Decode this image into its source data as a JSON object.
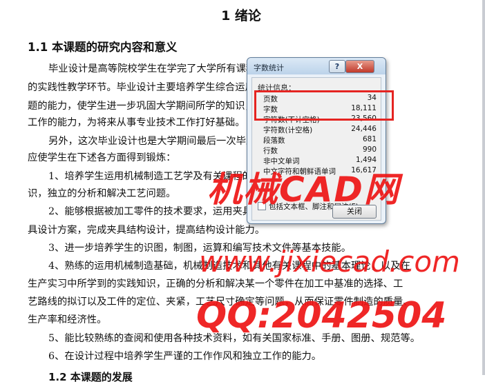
{
  "document": {
    "chapter_title": "1  绪论",
    "section_title": "1.1 本课题的研究内容和意义",
    "lines": [
      "毕业设计是高等院校学生在学完了大学所有课程之后进行的最后的一项重要",
      "的实践性教学环节。毕业设计主要培养学生综合运用所学知识解决生产实际问",
      "题的能力，使学生进一步巩固大学期间所学的知识，提高独立",
      "工作的能力，为将来从事专业技术工作打好基础。",
      "另外，这次毕业设计也是大学期间最后一次毕业设计，",
      "应使学生在下述各方面得到锻炼：",
      "1、培养学生运用机械制造工艺学及有关课程的知识学到的实践知",
      "识，独立的分析和解决工艺问题。",
      "2、能够根据被加工零件的技术要求，运用夹具设计学会拟定夹",
      "具设计方案，完成夹具结构设计，提高结构设计能力。",
      "3、进一步培养学生的识图，制图，运算和编写技术文件等基本技能。",
      "4、熟练的运用机械制造基础，机械制造技术和其他有关课程中的基本理论，以及在",
      "生产实习中所学到的实践知识，正确的分析和解决某一个零件在加工中基准的选择、工",
      "艺路线的拟订以及工件的定位、夹紧，工艺尺寸确定等问题，从而保证零件制造的质量、",
      "生产率和经济性。",
      "5、能比较熟练的查阅和使用各种技术资料，如有关国家标准、手册、图册、规范等。",
      "6、在设计过程中培养学生严谨的工作作风和独立工作的能力。"
    ],
    "cutoff_heading": "1.2 本课题的发展"
  },
  "dialog": {
    "title": "字数统计",
    "help_label": "?",
    "close_x_label": "X",
    "group_label": "统计信息：",
    "stats": [
      {
        "label": "页数",
        "value": "34"
      },
      {
        "label": "字数",
        "value": "18,111"
      },
      {
        "label": "字符数(不计空格)",
        "value": "23,560"
      },
      {
        "label": "字符数(计空格)",
        "value": "24,446"
      },
      {
        "label": "段落数",
        "value": "681"
      },
      {
        "label": "行数",
        "value": "990"
      },
      {
        "label": "非中文单词",
        "value": "1,494"
      },
      {
        "label": "中文字符和朝鲜语单词",
        "value": "16,617"
      }
    ],
    "checkbox_label": "包括文本框、脚注和尾注(F)",
    "close_button": "关闭"
  },
  "watermark": {
    "line1": "机械CAD网",
    "line2": "www.jixiecad.com",
    "line3": "QQ:2042504"
  },
  "colors": {
    "highlight": "#e52421",
    "watermark": "#ee1515"
  }
}
